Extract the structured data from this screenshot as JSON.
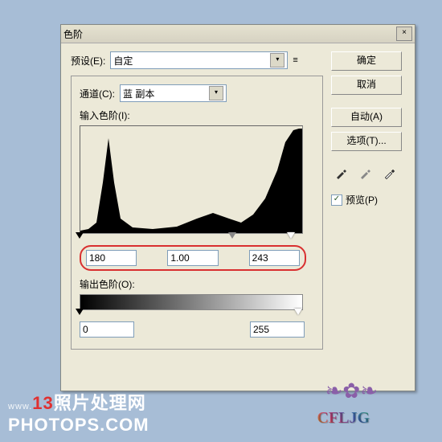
{
  "title": "色阶",
  "preset": {
    "label": "预设(E):",
    "value": "自定"
  },
  "channel": {
    "label": "通道(C):",
    "value": "蓝 副本"
  },
  "input_levels": {
    "label": "输入色阶(I):",
    "shadow": "180",
    "midtone": "1.00",
    "highlight": "243"
  },
  "output_levels": {
    "label": "输出色阶(O):",
    "low": "0",
    "high": "255"
  },
  "buttons": {
    "ok": "确定",
    "cancel": "取消",
    "auto": "自动(A)",
    "options": "选项(T)..."
  },
  "preview": {
    "label": "预览(P)",
    "checked": "✓"
  },
  "close": "×",
  "watermark": {
    "prefix": "www.",
    "num": "13",
    "line1": "照片处理网",
    "line2": "PHOTOPS.COM"
  },
  "logo": "CFLJG"
}
